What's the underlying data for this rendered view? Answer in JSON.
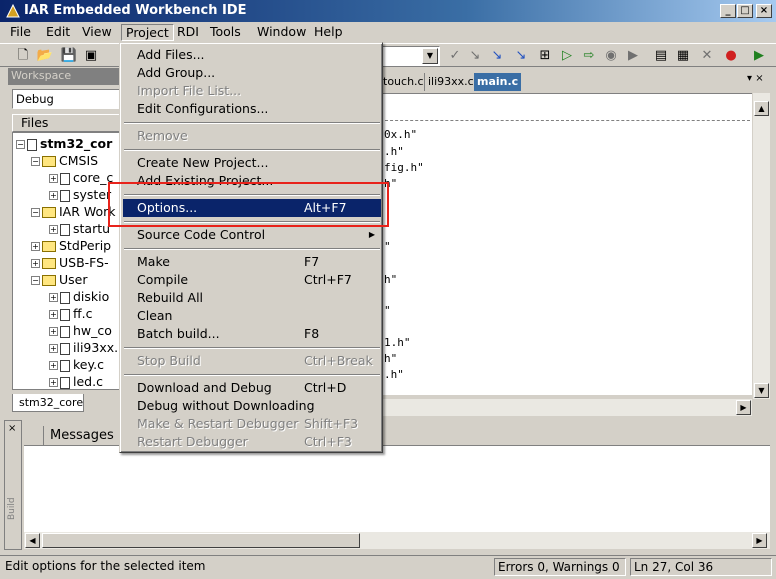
{
  "window": {
    "title": "IAR Embedded Workbench IDE"
  },
  "menubar": {
    "items": [
      "File",
      "Edit",
      "View",
      "Project",
      "RDI",
      "Tools",
      "Window",
      "Help"
    ],
    "active": "Project"
  },
  "workspace": {
    "header": "Workspace",
    "config": "Debug",
    "files_header": "Files",
    "tree": [
      {
        "label": "stm32_cor",
        "type": "project",
        "level": 0
      },
      {
        "label": "CMSIS",
        "type": "folder",
        "level": 1
      },
      {
        "label": "core_c",
        "type": "file",
        "level": 2
      },
      {
        "label": "syster",
        "type": "file",
        "level": 2
      },
      {
        "label": "IAR Work",
        "type": "folder",
        "level": 1
      },
      {
        "label": "startu",
        "type": "file",
        "level": 2
      },
      {
        "label": "StdPerip",
        "type": "folder",
        "level": 1
      },
      {
        "label": "USB-FS-",
        "type": "folder",
        "level": 1
      },
      {
        "label": "User",
        "type": "folder",
        "level": 1
      },
      {
        "label": "diskio",
        "type": "file",
        "level": 2
      },
      {
        "label": "ff.c",
        "type": "file",
        "level": 2
      },
      {
        "label": "hw_co",
        "type": "file",
        "level": 2
      },
      {
        "label": "ili93xx.",
        "type": "file",
        "level": 2
      },
      {
        "label": "key.c",
        "type": "file",
        "level": 2
      },
      {
        "label": "led.c",
        "type": "file",
        "level": 2
      }
    ],
    "tab": "stm32_core"
  },
  "editor": {
    "tabs": [
      "touch.c",
      "ili93xx.c",
      "main.c"
    ],
    "active_tab": "main.c",
    "lines": [
      "0x.h\"",
      ".h\"",
      "fig.h\"",
      "h\"",
      "\"",
      "h\"",
      "\"",
      "1.h\"",
      "h\"",
      ".h\""
    ]
  },
  "project_menu": {
    "items": [
      {
        "label": "Add Files...",
        "accel": "",
        "disabled": false
      },
      {
        "label": "Add Group...",
        "accel": "",
        "disabled": false
      },
      {
        "label": "Import File List...",
        "accel": "",
        "disabled": true
      },
      {
        "label": "Edit Configurations...",
        "accel": "",
        "disabled": false
      },
      {
        "sep": true
      },
      {
        "label": "Remove",
        "accel": "",
        "disabled": true
      },
      {
        "sep": true
      },
      {
        "label": "Create New Project...",
        "accel": "",
        "disabled": false
      },
      {
        "label": "Add Existing Project...",
        "accel": "",
        "disabled": false
      },
      {
        "sep": true
      },
      {
        "label": "Options...",
        "accel": "Alt+F7",
        "disabled": false,
        "selected": true
      },
      {
        "sep": true
      },
      {
        "label": "Source Code Control",
        "accel": "",
        "disabled": false,
        "submenu": true
      },
      {
        "sep": true
      },
      {
        "label": "Make",
        "accel": "F7",
        "disabled": false
      },
      {
        "label": "Compile",
        "accel": "Ctrl+F7",
        "disabled": false
      },
      {
        "label": "Rebuild All",
        "accel": "",
        "disabled": false
      },
      {
        "label": "Clean",
        "accel": "",
        "disabled": false
      },
      {
        "label": "Batch build...",
        "accel": "F8",
        "disabled": false
      },
      {
        "sep": true
      },
      {
        "label": "Stop Build",
        "accel": "Ctrl+Break",
        "disabled": true
      },
      {
        "sep": true
      },
      {
        "label": "Download and Debug",
        "accel": "Ctrl+D",
        "disabled": false
      },
      {
        "label": "Debug without Downloading",
        "accel": "",
        "disabled": false
      },
      {
        "label": "Make & Restart Debugger",
        "accel": "Shift+F3",
        "disabled": true
      },
      {
        "label": "Restart Debugger",
        "accel": "Ctrl+F3",
        "disabled": true
      }
    ]
  },
  "build": {
    "side_label": "Build",
    "messages_header": "Messages"
  },
  "statusbar": {
    "hint": "Edit options for the selected item",
    "errors": "Errors 0, Warnings 0",
    "position": "Ln 27, Col 36"
  },
  "colors": {
    "highlight_box": "#e8231b",
    "selection": "#0a246a",
    "title_start": "#0a246a"
  },
  "icons": [
    "new-file-icon",
    "open-folder-icon",
    "save-icon",
    "save-all-icon",
    "close-icon",
    "minimize-icon",
    "maximize-icon"
  ]
}
